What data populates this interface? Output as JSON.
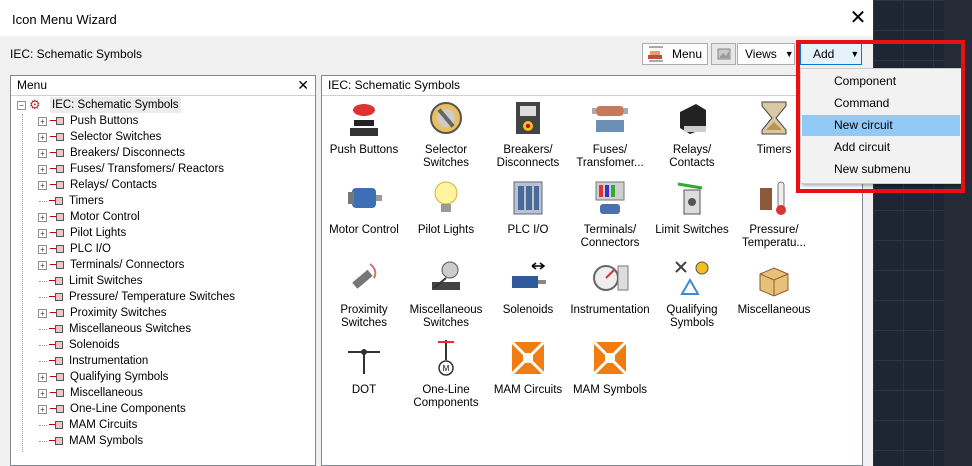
{
  "window": {
    "title": "Icon Menu Wizard",
    "close_glyph": "✕"
  },
  "toolbar": {
    "path_label": "IEC: Schematic Symbols",
    "menu_label": "Menu",
    "views_label": "Views",
    "add_label": "Add"
  },
  "menu_panel": {
    "header": "Menu",
    "close_glyph": "✕",
    "root": "IEC: Schematic Symbols",
    "items": [
      {
        "label": "Push Buttons",
        "expandable": true
      },
      {
        "label": "Selector Switches",
        "expandable": true
      },
      {
        "label": "Breakers/ Disconnects",
        "expandable": true
      },
      {
        "label": "Fuses/ Transfomers/ Reactors",
        "expandable": true
      },
      {
        "label": "Relays/ Contacts",
        "expandable": true
      },
      {
        "label": "Timers",
        "expandable": false
      },
      {
        "label": "Motor Control",
        "expandable": true
      },
      {
        "label": "Pilot Lights",
        "expandable": true
      },
      {
        "label": "PLC I/O",
        "expandable": true
      },
      {
        "label": "Terminals/ Connectors",
        "expandable": true
      },
      {
        "label": "Limit Switches",
        "expandable": false
      },
      {
        "label": "Pressure/ Temperature Switches",
        "expandable": false
      },
      {
        "label": "Proximity Switches",
        "expandable": true
      },
      {
        "label": "Miscellaneous Switches",
        "expandable": false
      },
      {
        "label": "Solenoids",
        "expandable": false
      },
      {
        "label": "Instrumentation",
        "expandable": false
      },
      {
        "label": "Qualifying Symbols",
        "expandable": true
      },
      {
        "label": "Miscellaneous",
        "expandable": true
      },
      {
        "label": "One-Line Components",
        "expandable": true
      },
      {
        "label": "MAM Circuits",
        "expandable": false
      },
      {
        "label": "MAM Symbols",
        "expandable": false
      }
    ]
  },
  "icons_panel": {
    "header": "IEC: Schematic Symbols",
    "icons": [
      {
        "line1": "Push Buttons",
        "line2": "",
        "icon": "push-button-icon"
      },
      {
        "line1": "Selector",
        "line2": "Switches",
        "icon": "selector-switch-icon"
      },
      {
        "line1": "Breakers/",
        "line2": "Disconnects",
        "icon": "breaker-icon"
      },
      {
        "line1": "Fuses/",
        "line2": "Transfomer...",
        "icon": "fuse-icon"
      },
      {
        "line1": "Relays/",
        "line2": "Contacts",
        "icon": "relay-icon"
      },
      {
        "line1": "Timers",
        "line2": "",
        "icon": "hourglass-icon"
      },
      {
        "line1": "Motor Control",
        "line2": "",
        "icon": "motor-icon"
      },
      {
        "line1": "Pilot Lights",
        "line2": "",
        "icon": "light-bulb-icon"
      },
      {
        "line1": "PLC I/O",
        "line2": "",
        "icon": "plc-icon"
      },
      {
        "line1": "Terminals/",
        "line2": "Connectors",
        "icon": "terminal-icon"
      },
      {
        "line1": "Limit Switches",
        "line2": "",
        "icon": "limit-switch-icon"
      },
      {
        "line1": "Pressure/",
        "line2": "Temperatu...",
        "icon": "thermometer-icon"
      },
      {
        "line1": "Proximity",
        "line2": "Switches",
        "icon": "proximity-icon"
      },
      {
        "line1": "Miscellaneous",
        "line2": "Switches",
        "icon": "misc-switch-icon"
      },
      {
        "line1": "Solenoids",
        "line2": "",
        "icon": "solenoid-icon"
      },
      {
        "line1": "Instrumentation",
        "line2": "",
        "icon": "gauge-icon"
      },
      {
        "line1": "Qualifying",
        "line2": "Symbols",
        "icon": "qualifying-icon"
      },
      {
        "line1": "Miscellaneous",
        "line2": "",
        "icon": "boxes-icon"
      },
      {
        "line1": "DOT",
        "line2": "",
        "icon": "dot-icon"
      },
      {
        "line1": "One-Line",
        "line2": "Components",
        "icon": "one-line-icon"
      },
      {
        "line1": "MAM Circuits",
        "line2": "",
        "icon": "mam-icon"
      },
      {
        "line1": "MAM Symbols",
        "line2": "",
        "icon": "mam-icon"
      }
    ]
  },
  "add_menu": {
    "items": [
      {
        "label": "Component",
        "selected": false
      },
      {
        "label": "Command",
        "selected": false
      },
      {
        "label": "New circuit",
        "selected": true
      },
      {
        "label": "Add circuit",
        "selected": false
      },
      {
        "label": "New submenu",
        "selected": false
      }
    ]
  },
  "colors": {
    "highlight": "#91c9f7",
    "callout": "#e81010",
    "mam_orange": "#f07d12"
  }
}
